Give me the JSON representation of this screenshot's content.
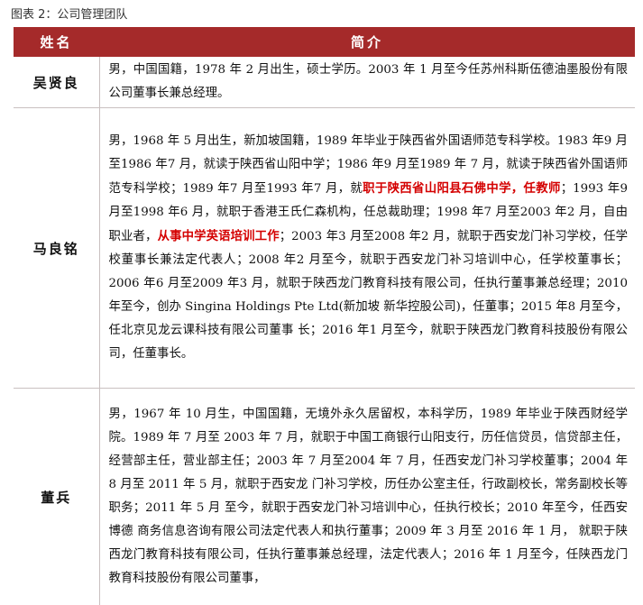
{
  "caption": "图表 2：公司管理团队",
  "table": {
    "headers": {
      "name": "姓名",
      "intro": "简介"
    },
    "rows": [
      {
        "name": "吴贤良",
        "segments": [
          {
            "text": "男，中国国籍，1978 年 2 月出生，硕士学历。2003 年 1 月至今任苏州科斯伍德油墨股份有限公司董事长兼总经理。",
            "highlight": false
          }
        ]
      },
      {
        "name": "马良铭",
        "segments": [
          {
            "text": "男，1968 年 5 月出生，新加坡国籍，1989 年毕业于陕西省外国语师范专科学校。1983 年9 月至1986 年7 月，就读于陕西省山阳中学；1986 年9 月至1989 年 7 月，就读于陕西省外国语师范专科学校；1989 年7 月至1993 年7 月，就",
            "highlight": false
          },
          {
            "text": "职于陕西省山阳县石佛中学，任教师",
            "highlight": true
          },
          {
            "text": "；1993 年9 月至1998 年6 月，就职于香港王氏仁森机构，任总裁助理；1998 年7 月至2003 年2 月，自由职业者，",
            "highlight": false
          },
          {
            "text": "从事中学英语培训工作",
            "highlight": true
          },
          {
            "text": "；2003 年3 月至2008 年2 月，就职于西安龙门补习学校，任学校董事长兼法定代表人；2008 年2 月至今，就职于西安龙门补习培训中心，任学校董事长；2006 年6 月至2009 年3 月，就职于陕西龙门教育科技有限公司，任执行董事兼总经理；2010 年至今，创办 Singina Holdings Pte Ltd(新加坡 新华控股公司)，任董事；2015 年8 月至今，任北京见龙云课科技有限公司董事 长；2016 年1 月至今，就职于陕西龙门教育科技股份有限公司，任董事长。",
            "highlight": false
          }
        ]
      },
      {
        "name": "董兵",
        "segments": [
          {
            "text": "男，1967 年 10 月生，中国国籍，无境外永久居留权，本科学历，1989 年毕业于陕西财经学院。1989 年 7 月至 2003 年 7 月，就职于中国工商银行山阳支行，历任信贷员，信贷部主任，经营部主任，营业部主任；2003 年 7 月至2004 年 7 月，任西安龙门补习学校董事；2004 年 8 月至 2011 年 5 月，就职于西安龙 门补习学校，历任办公室主任，行政副校长，常务副校长等职务；2011 年 5 月 至今，就职于西安龙门补习培训中心，任执行校长；2010 年至今，任西安博德 商务信息咨询有限公司法定代表人和执行董事；2009 年 3 月至 2016 年 1 月， 就职于陕西龙门教育科技有限公司，任执行董事兼总经理，法定代表人；2016 年 1 月至今，任陕西龙门教育科技股份有限公司董事，",
            "highlight": false
          }
        ]
      }
    ]
  }
}
